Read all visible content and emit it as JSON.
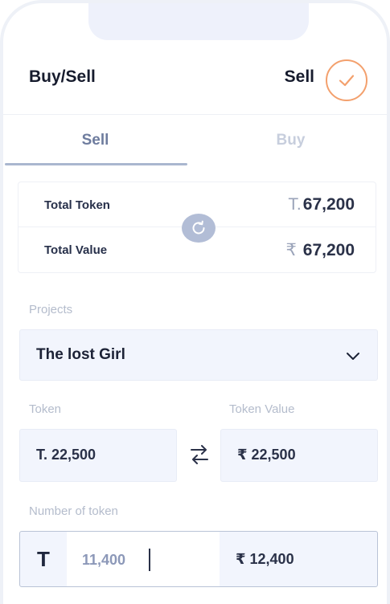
{
  "header": {
    "title": "Buy/Sell",
    "mode": "Sell",
    "confirm_icon": "check-icon"
  },
  "tabs": [
    {
      "label": "Sell",
      "active": true
    },
    {
      "label": "Buy",
      "active": false
    }
  ],
  "summary": {
    "total_token": {
      "label": "Total Token",
      "prefix": "T.",
      "value": "67,200"
    },
    "total_value": {
      "label": "Total Value",
      "prefix": "₹",
      "value": "67,200"
    },
    "refresh_icon": "refresh-icon"
  },
  "projects": {
    "label": "Projects",
    "selected": "The lost Girl"
  },
  "token": {
    "label": "Token",
    "value": "T. 22,500"
  },
  "token_value": {
    "label": "Token Value",
    "value": "₹ 22,500"
  },
  "swap_icon": "swap-arrows-icon",
  "number_of_token": {
    "label": "Number of token",
    "symbol": "T",
    "count": "11,400",
    "value": "₹ 12,400"
  },
  "colors": {
    "accent_orange": "#f3a06d",
    "field_bg": "#f2f5fd",
    "tab_active": "#6e7c9e",
    "tab_inactive": "#c7cedd"
  }
}
